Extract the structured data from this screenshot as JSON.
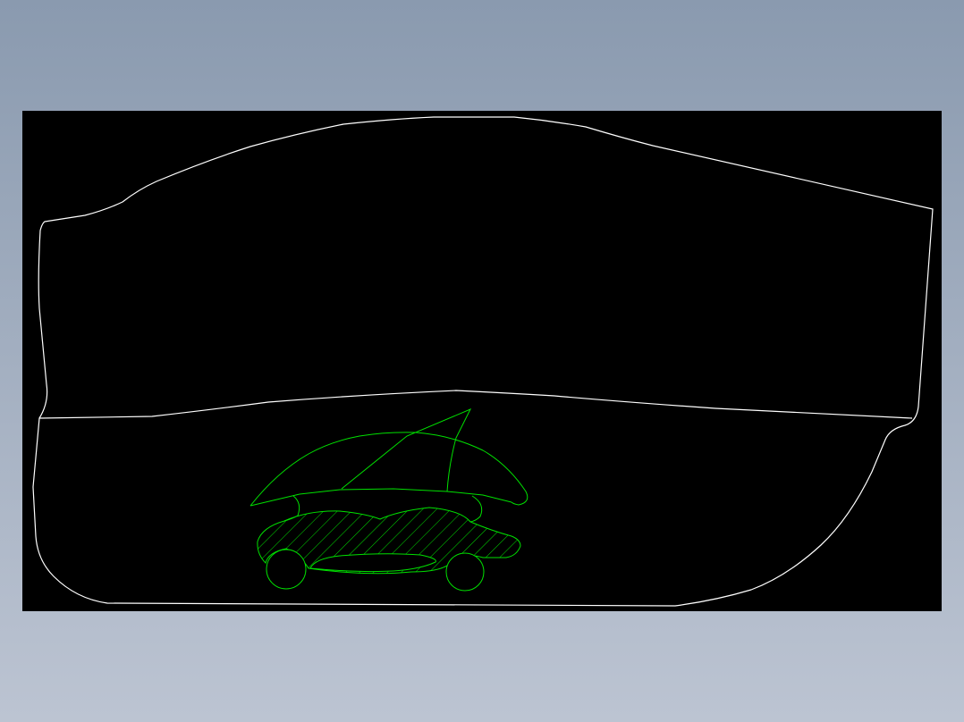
{
  "background": {
    "gradient_top": "#8a9aaf",
    "gradient_bottom": "#bcc4d2"
  },
  "viewport": {
    "background": "#000000"
  },
  "drawing": {
    "outline_color": "#ffffff",
    "sketch_color": "#00e000",
    "hatch_pattern": "diagonal"
  }
}
